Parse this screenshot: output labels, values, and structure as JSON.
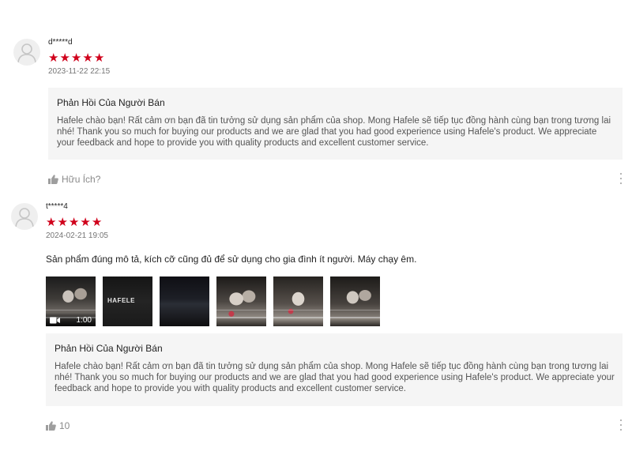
{
  "reviews": [
    {
      "username": "d*****d",
      "rating": 5,
      "stars": [
        "★",
        "★",
        "★",
        "★",
        "★"
      ],
      "time": "2023-11-22 22:15",
      "content": "",
      "seller_reply": {
        "title": "Phản Hồi Của Người Bán",
        "text": "Hafele chào bạn! Rất cảm ơn bạn đã tin tưởng sử dụng sản phẩm của shop. Mong Hafele sẽ tiếp tục đồng hành cùng bạn trong tương lai nhé! Thank you so much for buying our products and we are glad that you had good experience using Hafele's product. We appreciate your feedback and hope to provide you with quality products and excellent customer service."
      },
      "helpful_label": "Hữu Ích?"
    },
    {
      "username": "t*****4",
      "rating": 5,
      "stars": [
        "★",
        "★",
        "★",
        "★",
        "★"
      ],
      "time": "2024-02-21 19:05",
      "content": "Sản phẩm đúng mô tả, kích cỡ cũng đủ để sử dụng cho gia đình ít người. Máy chạy êm.",
      "media": {
        "video_duration": "1:00",
        "thumb_brand": "HAFELE"
      },
      "seller_reply": {
        "title": "Phản Hồi Của Người Bán",
        "text": "Hafele chào bạn! Rất cảm ơn bạn đã tin tưởng sử dụng sản phẩm của shop. Mong Hafele sẽ tiếp tục đồng hành cùng bạn trong tương lai nhé! Thank you so much for buying our products and we are glad that you had good experience using Hafele's product. We appreciate your feedback and hope to provide you with quality products and excellent customer service."
      },
      "helpful_count": "10"
    }
  ],
  "colors": {
    "star": "#d0011b",
    "reply_bg": "#f5f5f5",
    "muted_text": "#757575"
  }
}
